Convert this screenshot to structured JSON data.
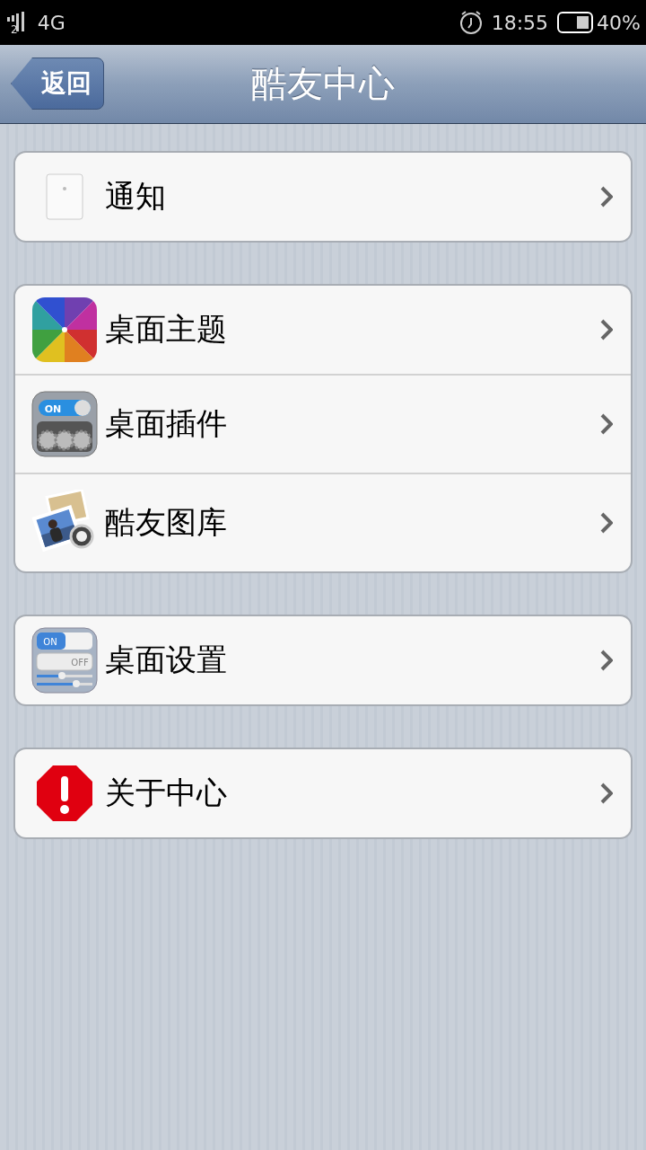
{
  "status_bar": {
    "sim": "2",
    "network": "4G",
    "time": "18:55",
    "battery": "40%"
  },
  "nav": {
    "back": "返回",
    "title": "酷友中心"
  },
  "groups": [
    {
      "rows": [
        {
          "label": "通知"
        }
      ]
    },
    {
      "rows": [
        {
          "label": "桌面主题"
        },
        {
          "label": "桌面插件",
          "icon_texts": [
            "ON"
          ]
        },
        {
          "label": "酷友图库"
        }
      ]
    },
    {
      "rows": [
        {
          "label": "桌面设置",
          "icon_texts": [
            "ON",
            "OFF"
          ]
        }
      ]
    },
    {
      "rows": [
        {
          "label": "关于中心"
        }
      ]
    }
  ]
}
